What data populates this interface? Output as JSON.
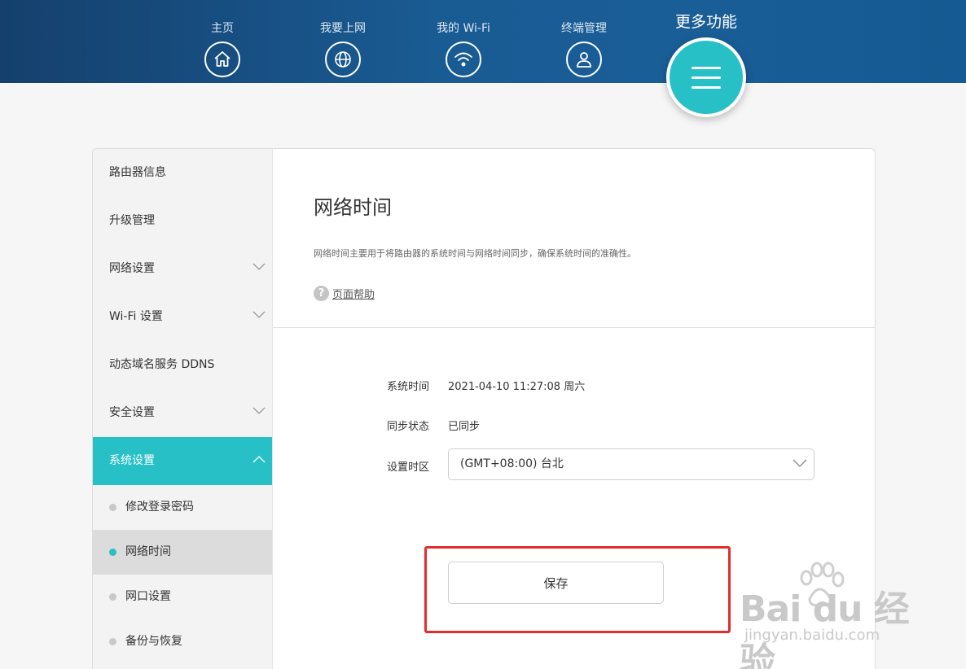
{
  "nav": {
    "items": [
      {
        "label": "主页",
        "icon": "home-icon"
      },
      {
        "label": "我要上网",
        "icon": "globe-icon"
      },
      {
        "label": "我的 Wi-Fi",
        "icon": "wifi-icon"
      },
      {
        "label": "终端管理",
        "icon": "user-icon"
      }
    ],
    "more_label": "更多功能"
  },
  "sidebar": {
    "items": [
      {
        "label": "路由器信息"
      },
      {
        "label": "升级管理"
      },
      {
        "label": "网络设置"
      },
      {
        "label": "Wi-Fi 设置"
      },
      {
        "label": "动态域名服务 DDNS"
      },
      {
        "label": "安全设置"
      },
      {
        "label": "系统设置"
      }
    ],
    "sub_items": [
      {
        "label": "修改登录密码"
      },
      {
        "label": "网络时间"
      },
      {
        "label": "网口设置"
      },
      {
        "label": "备份与恢复"
      }
    ]
  },
  "main": {
    "title": "网络时间",
    "description": "网络时间主要用于将路由器的系统时间与网络时间同步，确保系统时间的准确性。",
    "help_label": "页面帮助",
    "help_symbol": "?",
    "system_time_label": "系统时间",
    "system_time_value": "2021-04-10 11:27:08 周六",
    "sync_status_label": "同步状态",
    "sync_status_value": "已同步",
    "timezone_label": "设置时区",
    "timezone_value": "(GMT+08:00) 台北",
    "save_label": "保存"
  },
  "watermark": {
    "main": "Bai du 经验",
    "sub": "jingyan.baidu.com"
  },
  "colors": {
    "accent": "#27c0c6",
    "header": "#195b93",
    "highlight": "#e22c2c"
  }
}
